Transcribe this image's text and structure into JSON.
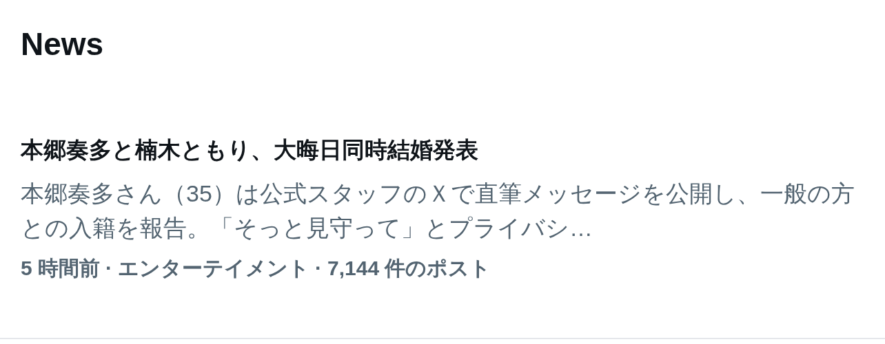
{
  "section_title": "News",
  "article": {
    "headline": "本郷奏多と楠木ともり、大晦日同時結婚発表",
    "summary": "本郷奏多さん（35）は公式スタッフのＸで直筆メッセージを公開し、一般の方との入籍を報告。「そっと見守って」とプライバシ…",
    "meta": [
      "5 時間前",
      "エンターテイメント",
      "7,144 件のポスト"
    ],
    "meta_separator": "·"
  }
}
